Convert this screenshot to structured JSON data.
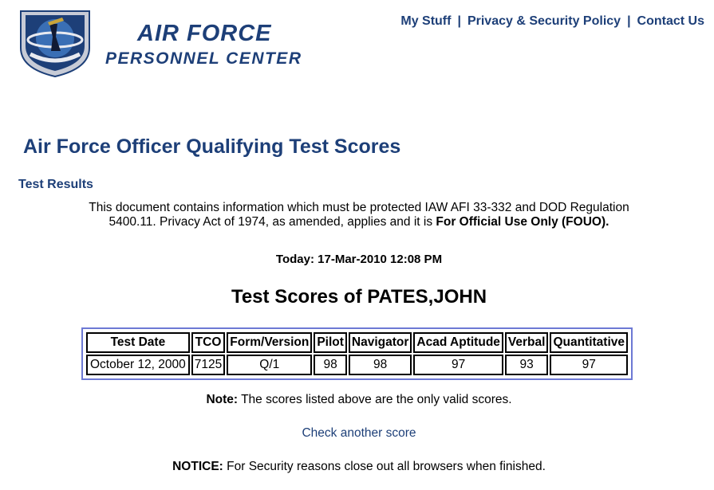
{
  "header": {
    "brand_line1": "AIR FORCE",
    "brand_line2": "PERSONNEL CENTER",
    "seal_text": "AIR FORCE PERSONNEL CENTER",
    "nav": [
      {
        "label": "My Stuff"
      },
      {
        "label": "Privacy & Security Policy"
      },
      {
        "label": "Contact Us"
      }
    ],
    "nav_separator": "|"
  },
  "main": {
    "page_title": "Air Force Officer Qualifying Test Scores",
    "section_heading": "Test Results",
    "privacy_text": "This document contains information which must be protected IAW AFI 33-332 and DOD Regulation 5400.11. Privacy Act of 1974, as amended, applies and it is ",
    "privacy_bold": "For Official Use Only (FOUO).",
    "today": "Today: 17-Mar-2010 12:08 PM",
    "scores_heading": "Test Scores of PATES,JOHN",
    "table": {
      "headers": [
        "Test Date",
        "TCO",
        "Form/Version",
        "Pilot",
        "Navigator",
        "Acad Aptitude",
        "Verbal",
        "Quantitative"
      ],
      "rows": [
        [
          "October 12, 2000",
          "7125",
          "Q/1",
          "98",
          "98",
          "97",
          "93",
          "97"
        ]
      ]
    },
    "note_label": "Note:",
    "note_text": " The scores listed above are the only valid scores.",
    "check_link": "Check another score",
    "notice_label": "NOTICE:",
    "notice_text": " For Security reasons close out all browsers when finished."
  },
  "colors": {
    "brand": "#1d3f78",
    "table_frame": "#6d79d4"
  }
}
